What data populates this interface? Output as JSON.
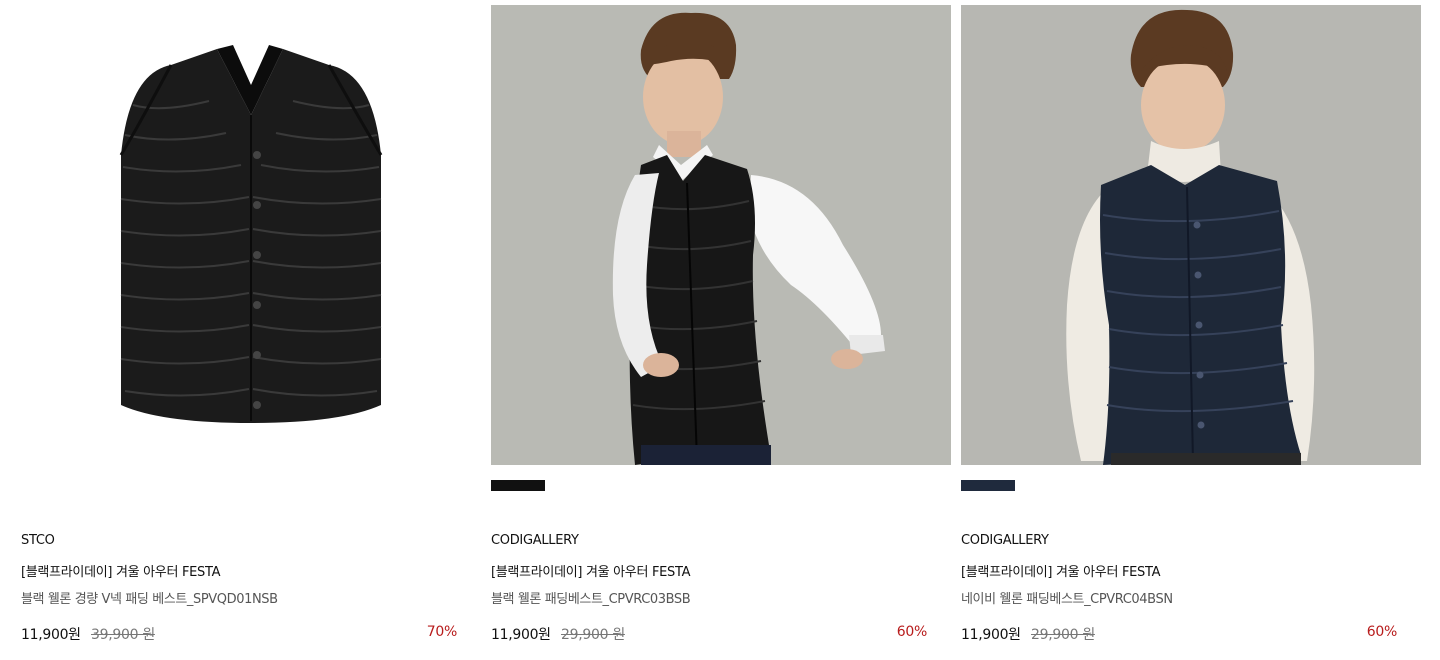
{
  "products": [
    {
      "brand": "STCO",
      "promo": "[블랙프라이데이] 겨울 아우터 FESTA",
      "name": "블랙 웰론 경량 V넥 패딩 베스트_SPVQD01NSB",
      "sale_price": "11,900원",
      "original_price": "39,900 원",
      "discount": "70%",
      "image": "black-quilted-vest-flatlay"
    },
    {
      "brand": "CODIGALLERY",
      "promo": "[블랙프라이데이] 겨울 아우터 FESTA",
      "name": "블랙 웰론 패딩베스트_CPVRC03BSB",
      "sale_price": "11,900원",
      "original_price": "29,900 원",
      "discount": "60%",
      "image": "model-black-quilted-vest",
      "swatch_color": "#111111"
    },
    {
      "brand": "CODIGALLERY",
      "promo": "[블랙프라이데이] 겨울 아우터 FESTA",
      "name": "네이비 웰론 패딩베스트_CPVRC04BSN",
      "sale_price": "11,900원",
      "original_price": "29,900 원",
      "discount": "60%",
      "image": "model-navy-quilted-vest",
      "swatch_color": "#1f2a3d"
    }
  ],
  "colors": {
    "discount": "#b81c1c",
    "text": "#111111",
    "muted": "#777777",
    "photo_background": "#b9bab4"
  }
}
